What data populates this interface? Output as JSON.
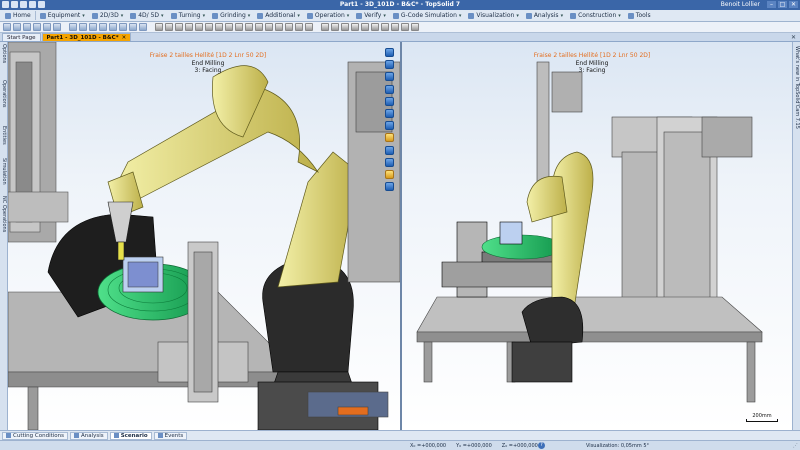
{
  "app": {
    "title": "Part1 - 3D_101D - B&C* - TopSolid 7",
    "user": "Benoit Lollier",
    "window_controls": [
      "–",
      "□",
      "✕"
    ]
  },
  "menu": [
    {
      "label": "Home",
      "icon": "home-icon"
    },
    {
      "label": "Equipment",
      "icon": "equipment-icon"
    },
    {
      "label": "2D/3D",
      "icon": "2d3d-icon"
    },
    {
      "label": "4D/ 5D",
      "icon": "4d5d-icon"
    },
    {
      "label": "Turning",
      "icon": "turning-icon"
    },
    {
      "label": "Grinding",
      "icon": "grinding-icon"
    },
    {
      "label": "Additional",
      "icon": "additional-icon"
    },
    {
      "label": "Operation",
      "icon": "operation-icon"
    },
    {
      "label": "Verify",
      "icon": "verify-icon"
    },
    {
      "label": "G-Code Simulation",
      "icon": "gcode-icon"
    },
    {
      "label": "Visualization",
      "icon": "visualization-icon"
    },
    {
      "label": "Analysis",
      "icon": "analysis-icon"
    },
    {
      "label": "Construction",
      "icon": "construction-icon"
    },
    {
      "label": "Tools",
      "icon": "tools-icon"
    }
  ],
  "doc_tabs": [
    {
      "label": "Start Page",
      "active": false
    },
    {
      "label": "Part1 - 3D_101D - B&C*",
      "active": true
    }
  ],
  "left_side_tabs": [
    "Options",
    "Operations",
    "Entities",
    "Simulation",
    "NC Operations"
  ],
  "right_side_tab": "What's new in TopSolid'Cam 7.15",
  "viewports": {
    "left": {
      "line1": "Fraise 2 tailles Hellité [1D 2 Lnr 50 2D]",
      "line2": "End Milling",
      "line3": "3: Facing"
    },
    "right": {
      "line1": "Fraise 2 tailles Hellité [1D 2 Lnr 50 2D]",
      "line2": "End Milling",
      "line3": "3: Facing",
      "scale_label": "200mm"
    }
  },
  "bottom_tabs": [
    {
      "label": "Cutting Conditions",
      "active": false
    },
    {
      "label": "Analysis",
      "active": false
    },
    {
      "label": "Scenario",
      "active": true
    },
    {
      "label": "Events",
      "active": false
    }
  ],
  "status": {
    "x": "X₀ =+000,000",
    "y": "Y₀ =+000,000",
    "z": "Z₀ =+000,000",
    "visualization": "Visualization: 0,05mm 5°"
  },
  "colors": {
    "accent_tab": "#f5a400",
    "robot_yellow": "#e6e38a",
    "table_green": "#1fc46a",
    "hover_title": "#e36d1e"
  }
}
